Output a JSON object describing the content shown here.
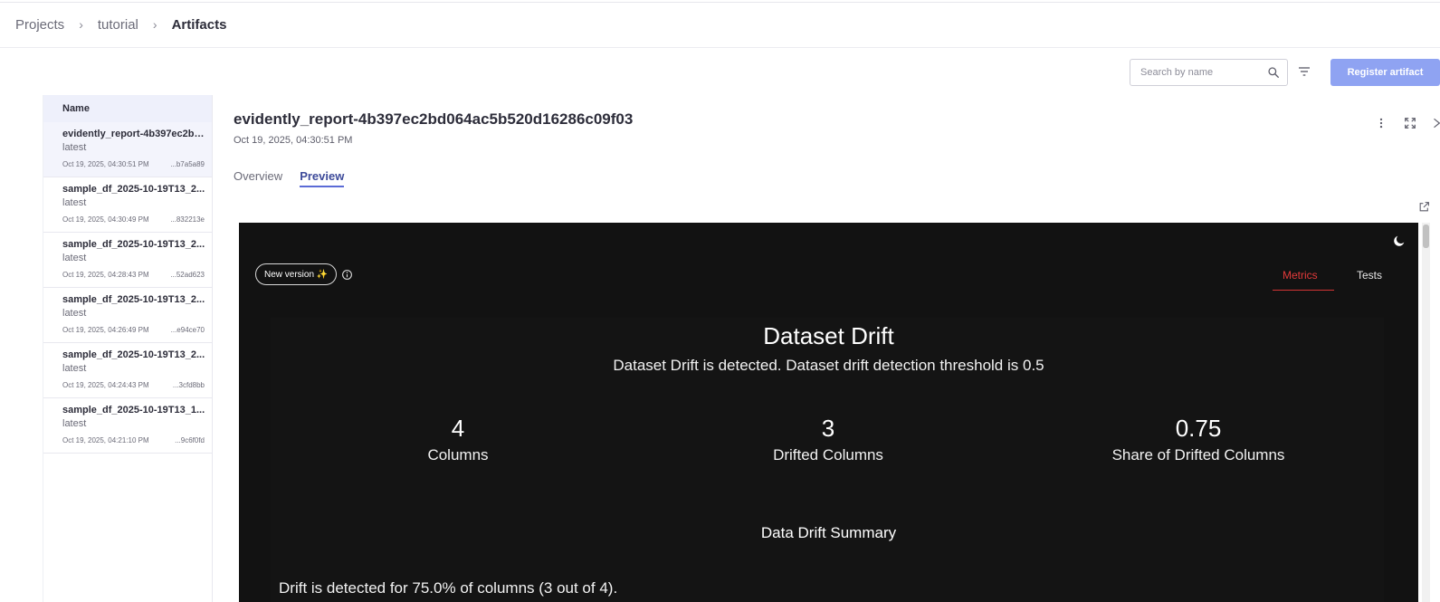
{
  "breadcrumb": {
    "items": [
      "Projects",
      "tutorial",
      "Artifacts"
    ]
  },
  "toolbar": {
    "search_placeholder": "Search by name",
    "register_label": "Register artifact"
  },
  "artifact_list": {
    "header": "Name",
    "items": [
      {
        "name": "evidently_report-4b397ec2bd064ac5b520d16286c09f03",
        "tag": "latest",
        "date": "Oct 19, 2025, 04:30:51 PM",
        "hash": "...b7a5a89"
      },
      {
        "name": "sample_df_2025-10-19T13_2...",
        "tag": "latest",
        "date": "Oct 19, 2025, 04:30:49 PM",
        "hash": "...832213e"
      },
      {
        "name": "sample_df_2025-10-19T13_2...",
        "tag": "latest",
        "date": "Oct 19, 2025, 04:28:43 PM",
        "hash": "...52ad623"
      },
      {
        "name": "sample_df_2025-10-19T13_2...",
        "tag": "latest",
        "date": "Oct 19, 2025, 04:26:49 PM",
        "hash": "...e94ce70"
      },
      {
        "name": "sample_df_2025-10-19T13_2...",
        "tag": "latest",
        "date": "Oct 19, 2025, 04:24:43 PM",
        "hash": "...3cfd8bb"
      },
      {
        "name": "sample_df_2025-10-19T13_1...",
        "tag": "latest",
        "date": "Oct 19, 2025, 04:21:10 PM",
        "hash": "...9c6f0fd"
      }
    ]
  },
  "detail": {
    "title": "evidently_report-4b397ec2bd064ac5b520d16286c09f03",
    "date": "Oct 19, 2025, 04:30:51 PM",
    "tabs": [
      "Overview",
      "Preview"
    ],
    "active_tab": "Preview"
  },
  "report": {
    "new_version_label": "New version ✨",
    "tabs": [
      "Metrics",
      "Tests"
    ],
    "active_tab": "Metrics",
    "title": "Dataset Drift",
    "subtitle": "Dataset Drift is detected. Dataset drift detection threshold is 0.5",
    "stats": [
      {
        "value": "4",
        "label": "Columns"
      },
      {
        "value": "3",
        "label": "Drifted Columns"
      },
      {
        "value": "0.75",
        "label": "Share of Drifted Columns"
      }
    ],
    "summary_title": "Data Drift Summary",
    "summary_text": "Drift is detected for 75.0% of columns (3 out of 4)."
  },
  "colors": {
    "accent": "#5b6bd6",
    "register_button": "#8fa3f2",
    "report_bg": "#121212",
    "metrics_tab": "#e23a3a"
  },
  "icons": {
    "search": "search-icon",
    "filter": "filter-icon",
    "more": "more-vertical-icon",
    "expand": "fullscreen-icon",
    "close": "close-icon",
    "external": "external-link-icon",
    "theme": "moon-icon",
    "info": "info-icon"
  }
}
